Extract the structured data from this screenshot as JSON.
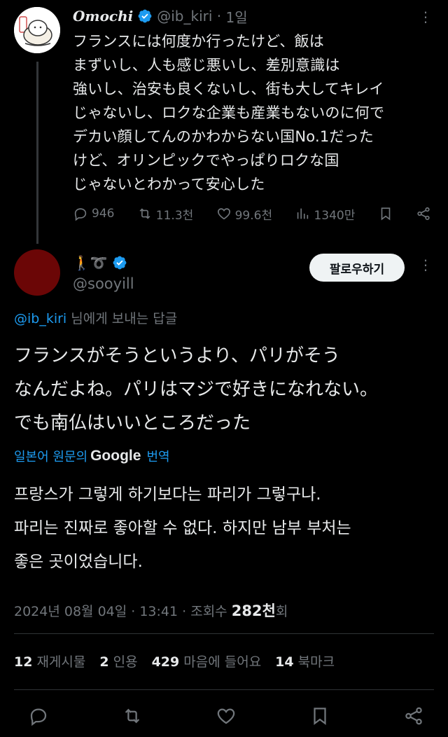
{
  "parent": {
    "display_name": "Omochi",
    "handle": "@ib_kiri",
    "time": "1일",
    "avatar_text": "おもち",
    "text": "フランスには何度か行ったけど、飯は\nまずいし、人も感じ悪いし、差別意識は\n強いし、治安も良くないし、街も大してキレイ\nじゃないし、ロクな企業も産業もないのに何で\nデカい顔してんのかわからない国No.1だった\nけど、オリンピックでやっぱりロクな国\nじゃないとわかって安心した",
    "replies": "946",
    "reposts": "11.3천",
    "likes": "99.6천",
    "views": "1340만",
    "more_icon": "more-icon"
  },
  "main": {
    "display_name": "🚶‍➰",
    "handle": "@sooyill",
    "follow_label": "팔로우하기",
    "reply_to_mention": "@ib_kiri",
    "reply_to_suffix": " 님에게 보내는 답글",
    "text": "フランスがそうというより、パリがそう\nなんだよね。パリはマジで好きになれない。\nでも南仏はいいところだった",
    "translate_prefix": "일본어 원문의",
    "translate_brand": "Google",
    "translate_suffix": "번역",
    "translated_text": "프랑스가 그렇게 하기보다는 파리가 그렇구나.\n파리는 진짜로 좋아할 수 없다. 하지만 남부 부처는\n좋은 곳이었습니다.",
    "date": "2024년 08월 04일 · 13:41 · 조회수 ",
    "views_count": "282천",
    "views_suffix": "회",
    "stats": {
      "reposts_count": "12",
      "reposts_label": "재게시물",
      "quotes_count": "2",
      "quotes_label": "인용",
      "likes_count": "429",
      "likes_label": "마음에 들어요",
      "bookmarks_count": "14",
      "bookmarks_label": "북마크"
    }
  },
  "colors": {
    "background": "#000000",
    "text": "#e7e9ea",
    "muted": "#71767b",
    "accent": "#1d9bf0",
    "avatar_main": "#6b0606"
  }
}
